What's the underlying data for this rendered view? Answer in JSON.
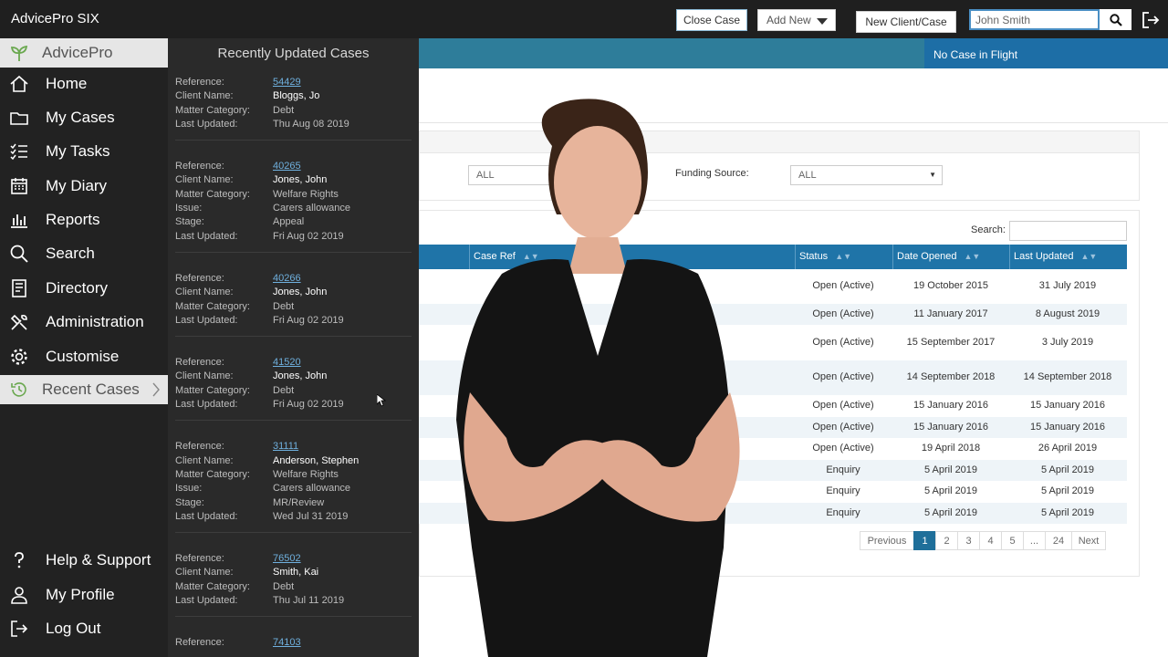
{
  "app": {
    "title": "AdvicePro SIX"
  },
  "topbar": {
    "close_case": "Close Case",
    "add_new": "Add New",
    "new_client_case": "New Client/Case",
    "search_value": "John Smith"
  },
  "case_banner": "No Case in Flight",
  "filters": {
    "first_select": "ALL",
    "funding_label": "Funding Source:",
    "funding_select": "ALL"
  },
  "table": {
    "search_label": "Search:",
    "columns": [
      "Case Ref",
      "Status",
      "Date Opened",
      "Last Updated"
    ],
    "rows": [
      {
        "status": "Open (Active)",
        "opened": "19 October 2015",
        "updated": "31 July 2019"
      },
      {
        "status": "Open (Active)",
        "opened": "11 January 2017",
        "updated": "8 August 2019"
      },
      {
        "status": "Open (Active)",
        "opened": "15 September 2017",
        "updated": "3 July 2019"
      },
      {
        "status": "Open (Active)",
        "opened": "14 September 2018",
        "updated": "14 September 2018"
      },
      {
        "status": "Open (Active)",
        "opened": "15 January 2016",
        "updated": "15 January 2016"
      },
      {
        "status": "Open (Active)",
        "opened": "15 January 2016",
        "updated": "15 January 2016"
      },
      {
        "status": "Open (Active)",
        "opened": "19 April 2018",
        "updated": "26 April 2019"
      },
      {
        "status": "Enquiry",
        "opened": "5 April 2019",
        "updated": "5 April 2019"
      },
      {
        "status": "Enquiry",
        "opened": "5 April 2019",
        "updated": "5 April 2019"
      },
      {
        "status": "Enquiry",
        "opened": "5 April 2019",
        "updated": "5 April 2019"
      }
    ]
  },
  "pagination": [
    "Previous",
    "1",
    "2",
    "3",
    "4",
    "5",
    "...",
    "24",
    "Next"
  ],
  "sidebar": {
    "brand": "AdvicePro",
    "items": [
      {
        "label": "Home",
        "icon": "home-icon"
      },
      {
        "label": "My Cases",
        "icon": "folder-icon"
      },
      {
        "label": "My Tasks",
        "icon": "tasks-icon"
      },
      {
        "label": "My Diary",
        "icon": "calendar-icon"
      },
      {
        "label": "Reports",
        "icon": "bar-chart-icon"
      },
      {
        "label": "Search",
        "icon": "search-icon"
      },
      {
        "label": "Directory",
        "icon": "book-icon"
      },
      {
        "label": "Administration",
        "icon": "tools-icon"
      },
      {
        "label": "Customise",
        "icon": "gear-icon"
      },
      {
        "label": "Recent Cases",
        "icon": "history-icon"
      },
      {
        "label": "Help & Support",
        "icon": "help-icon"
      },
      {
        "label": "My Profile",
        "icon": "user-icon"
      },
      {
        "label": "Log Out",
        "icon": "logout-icon"
      }
    ]
  },
  "recent": {
    "title": "Recently Updated Cases",
    "cases": [
      {
        "fields": [
          [
            "Reference:",
            "54429"
          ],
          [
            "Client Name:",
            "Bloggs, Jo"
          ],
          [
            "Matter Category:",
            "Debt"
          ],
          [
            "Last Updated:",
            "Thu Aug 08 2019"
          ]
        ]
      },
      {
        "fields": [
          [
            "Reference:",
            "40265"
          ],
          [
            "Client Name:",
            "Jones, John"
          ],
          [
            "Matter Category:",
            "Welfare Rights"
          ],
          [
            "Issue:",
            "Carers allowance"
          ],
          [
            "Stage:",
            "Appeal"
          ],
          [
            "Last Updated:",
            "Fri Aug 02 2019"
          ]
        ]
      },
      {
        "fields": [
          [
            "Reference:",
            "40266"
          ],
          [
            "Client Name:",
            "Jones, John"
          ],
          [
            "Matter Category:",
            "Debt"
          ],
          [
            "Last Updated:",
            "Fri Aug 02 2019"
          ]
        ]
      },
      {
        "fields": [
          [
            "Reference:",
            "41520"
          ],
          [
            "Client Name:",
            "Jones, John"
          ],
          [
            "Matter Category:",
            "Debt"
          ],
          [
            "Last Updated:",
            "Fri Aug 02 2019"
          ]
        ]
      },
      {
        "fields": [
          [
            "Reference:",
            "31111"
          ],
          [
            "Client Name:",
            "Anderson, Stephen"
          ],
          [
            "Matter Category:",
            "Welfare Rights"
          ],
          [
            "Issue:",
            "Carers allowance"
          ],
          [
            "Stage:",
            "MR/Review"
          ],
          [
            "Last Updated:",
            "Wed Jul 31 2019"
          ]
        ]
      },
      {
        "fields": [
          [
            "Reference:",
            "76502"
          ],
          [
            "Client Name:",
            "Smith, Kai"
          ],
          [
            "Matter Category:",
            "Debt"
          ],
          [
            "Last Updated:",
            "Thu Jul 11 2019"
          ]
        ]
      },
      {
        "fields": [
          [
            "Reference:",
            "74103"
          ]
        ]
      }
    ]
  }
}
